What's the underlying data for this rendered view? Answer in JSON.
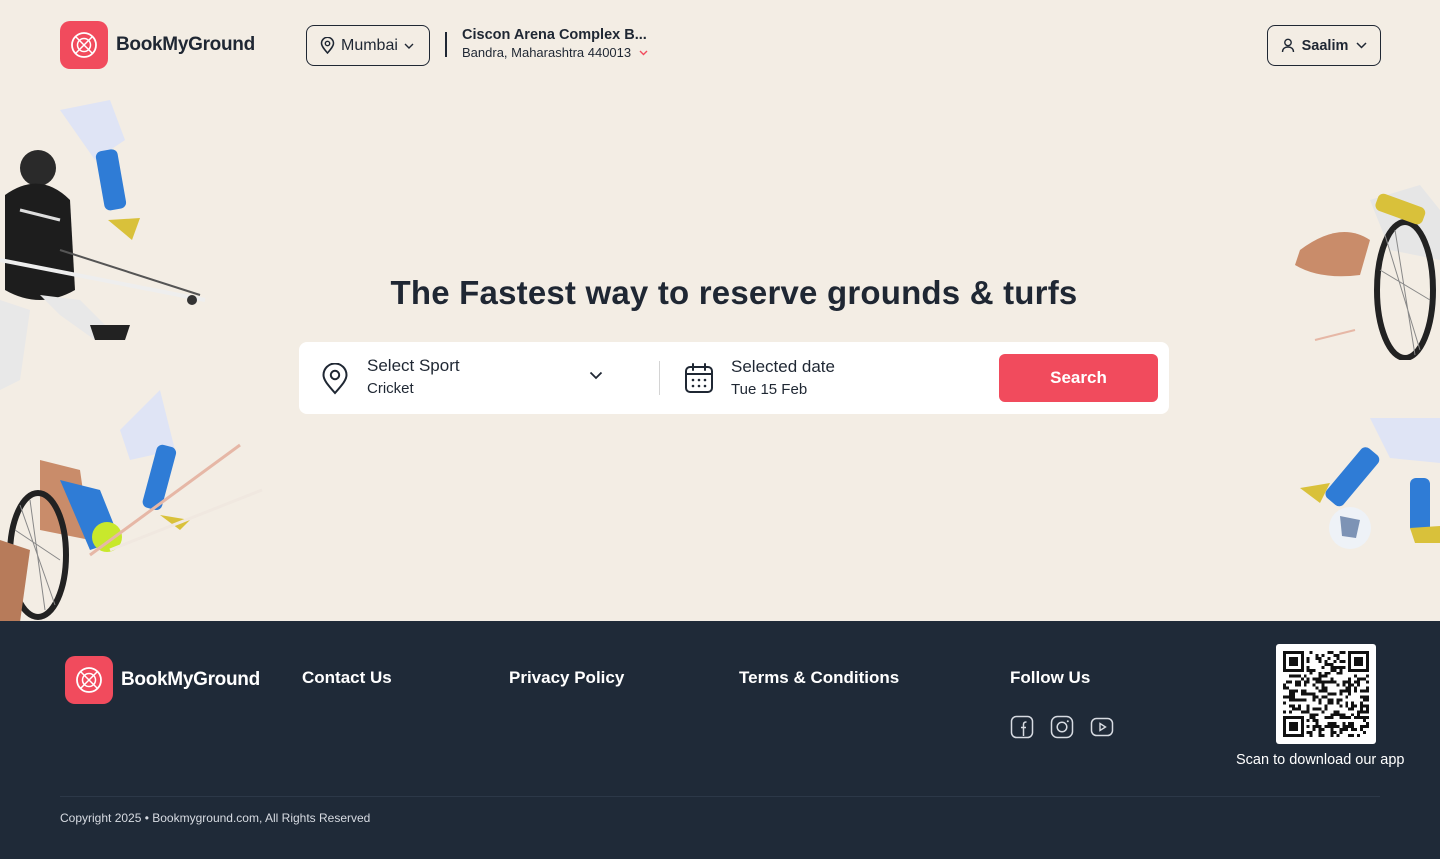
{
  "brand": {
    "name": "BookMyGround",
    "color": "#f14b5d"
  },
  "header": {
    "city": "Mumbai",
    "venue_name": "Ciscon Arena Complex  B...",
    "venue_address": "Bandra, Maharashtra 440013",
    "user_name": "Saalim"
  },
  "hero": {
    "title": "The Fastest way to reserve grounds & turfs",
    "sport_label": "Select Sport",
    "sport_value": "Cricket",
    "date_label": "Selected date",
    "date_value": "Tue 15 Feb",
    "search_label": "Search"
  },
  "footer": {
    "brand": "BookMyGround",
    "links": [
      "Contact Us",
      "Privacy Policy",
      "Terms & Conditions"
    ],
    "follow_label": "Follow Us",
    "socials": [
      "facebook-icon",
      "instagram-icon",
      "youtube-icon"
    ],
    "qr_caption": "Scan to download our app",
    "copyright": "Copyright 2025  •  Bookmyground.com, All Rights Reserved"
  },
  "colors": {
    "background": "#f3ede4",
    "footer": "#1f2a38",
    "text": "#1f2733",
    "accent": "#f14b5d"
  }
}
